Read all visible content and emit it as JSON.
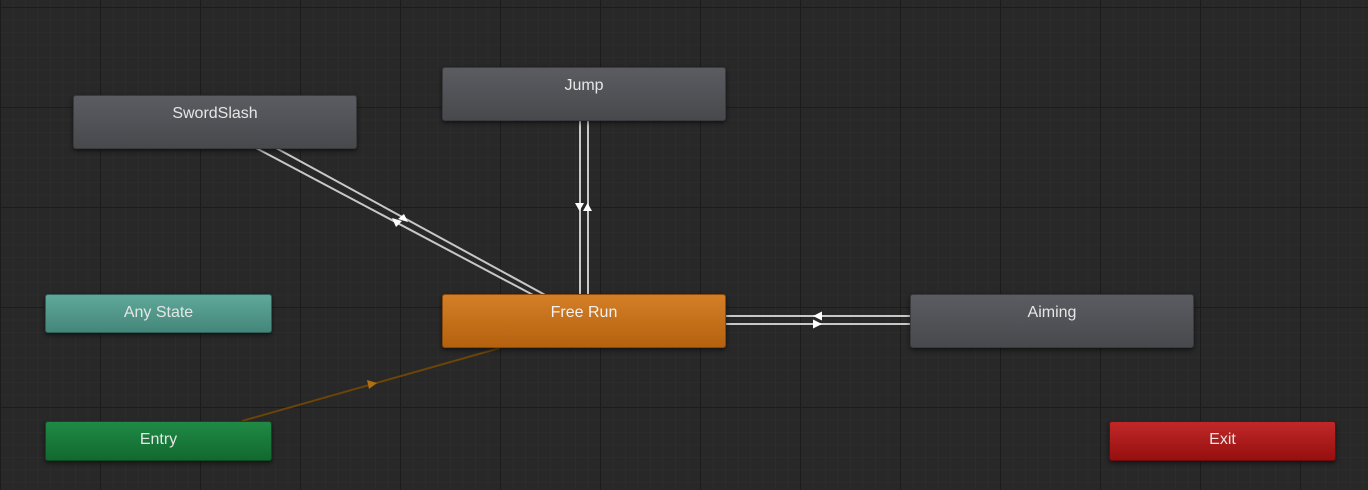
{
  "animator": {
    "states": {
      "sword_slash": "SwordSlash",
      "jump": "Jump",
      "any_state": "Any State",
      "free_run": "Free Run",
      "aiming": "Aiming",
      "entry": "Entry",
      "exit": "Exit"
    },
    "colors": {
      "default_state": "#54555a",
      "default_state_highlight": "#ff7f00",
      "any_state": "#52998b",
      "entry": "#178140",
      "exit": "#ad1919",
      "transition": "#c8c8c8",
      "default_transition": "#6b4408",
      "grid": "#282828"
    }
  }
}
